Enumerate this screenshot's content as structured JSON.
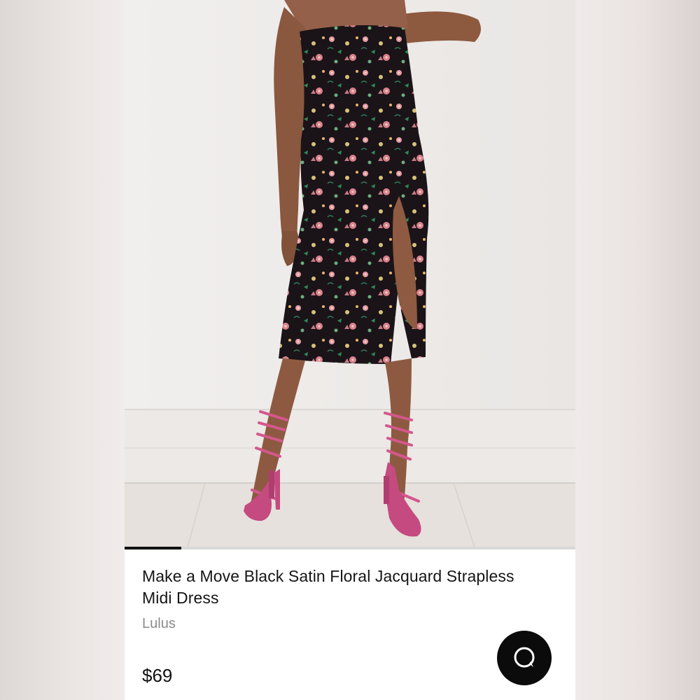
{
  "product": {
    "title": "Make a Move Black Satin Floral Jacquard Strapless Midi Dress",
    "brand": "Lulus",
    "price": "$69",
    "image_alt": "Model wearing black floral jacquard strapless midi dress with pink strappy heels"
  },
  "gallery": {
    "progress": 0.125
  },
  "chat": {
    "icon": "chat-bubble-icon"
  },
  "colors": {
    "dress": "#1a1418",
    "heels": "#d4578d",
    "chat_button": "#0b0b0b"
  }
}
